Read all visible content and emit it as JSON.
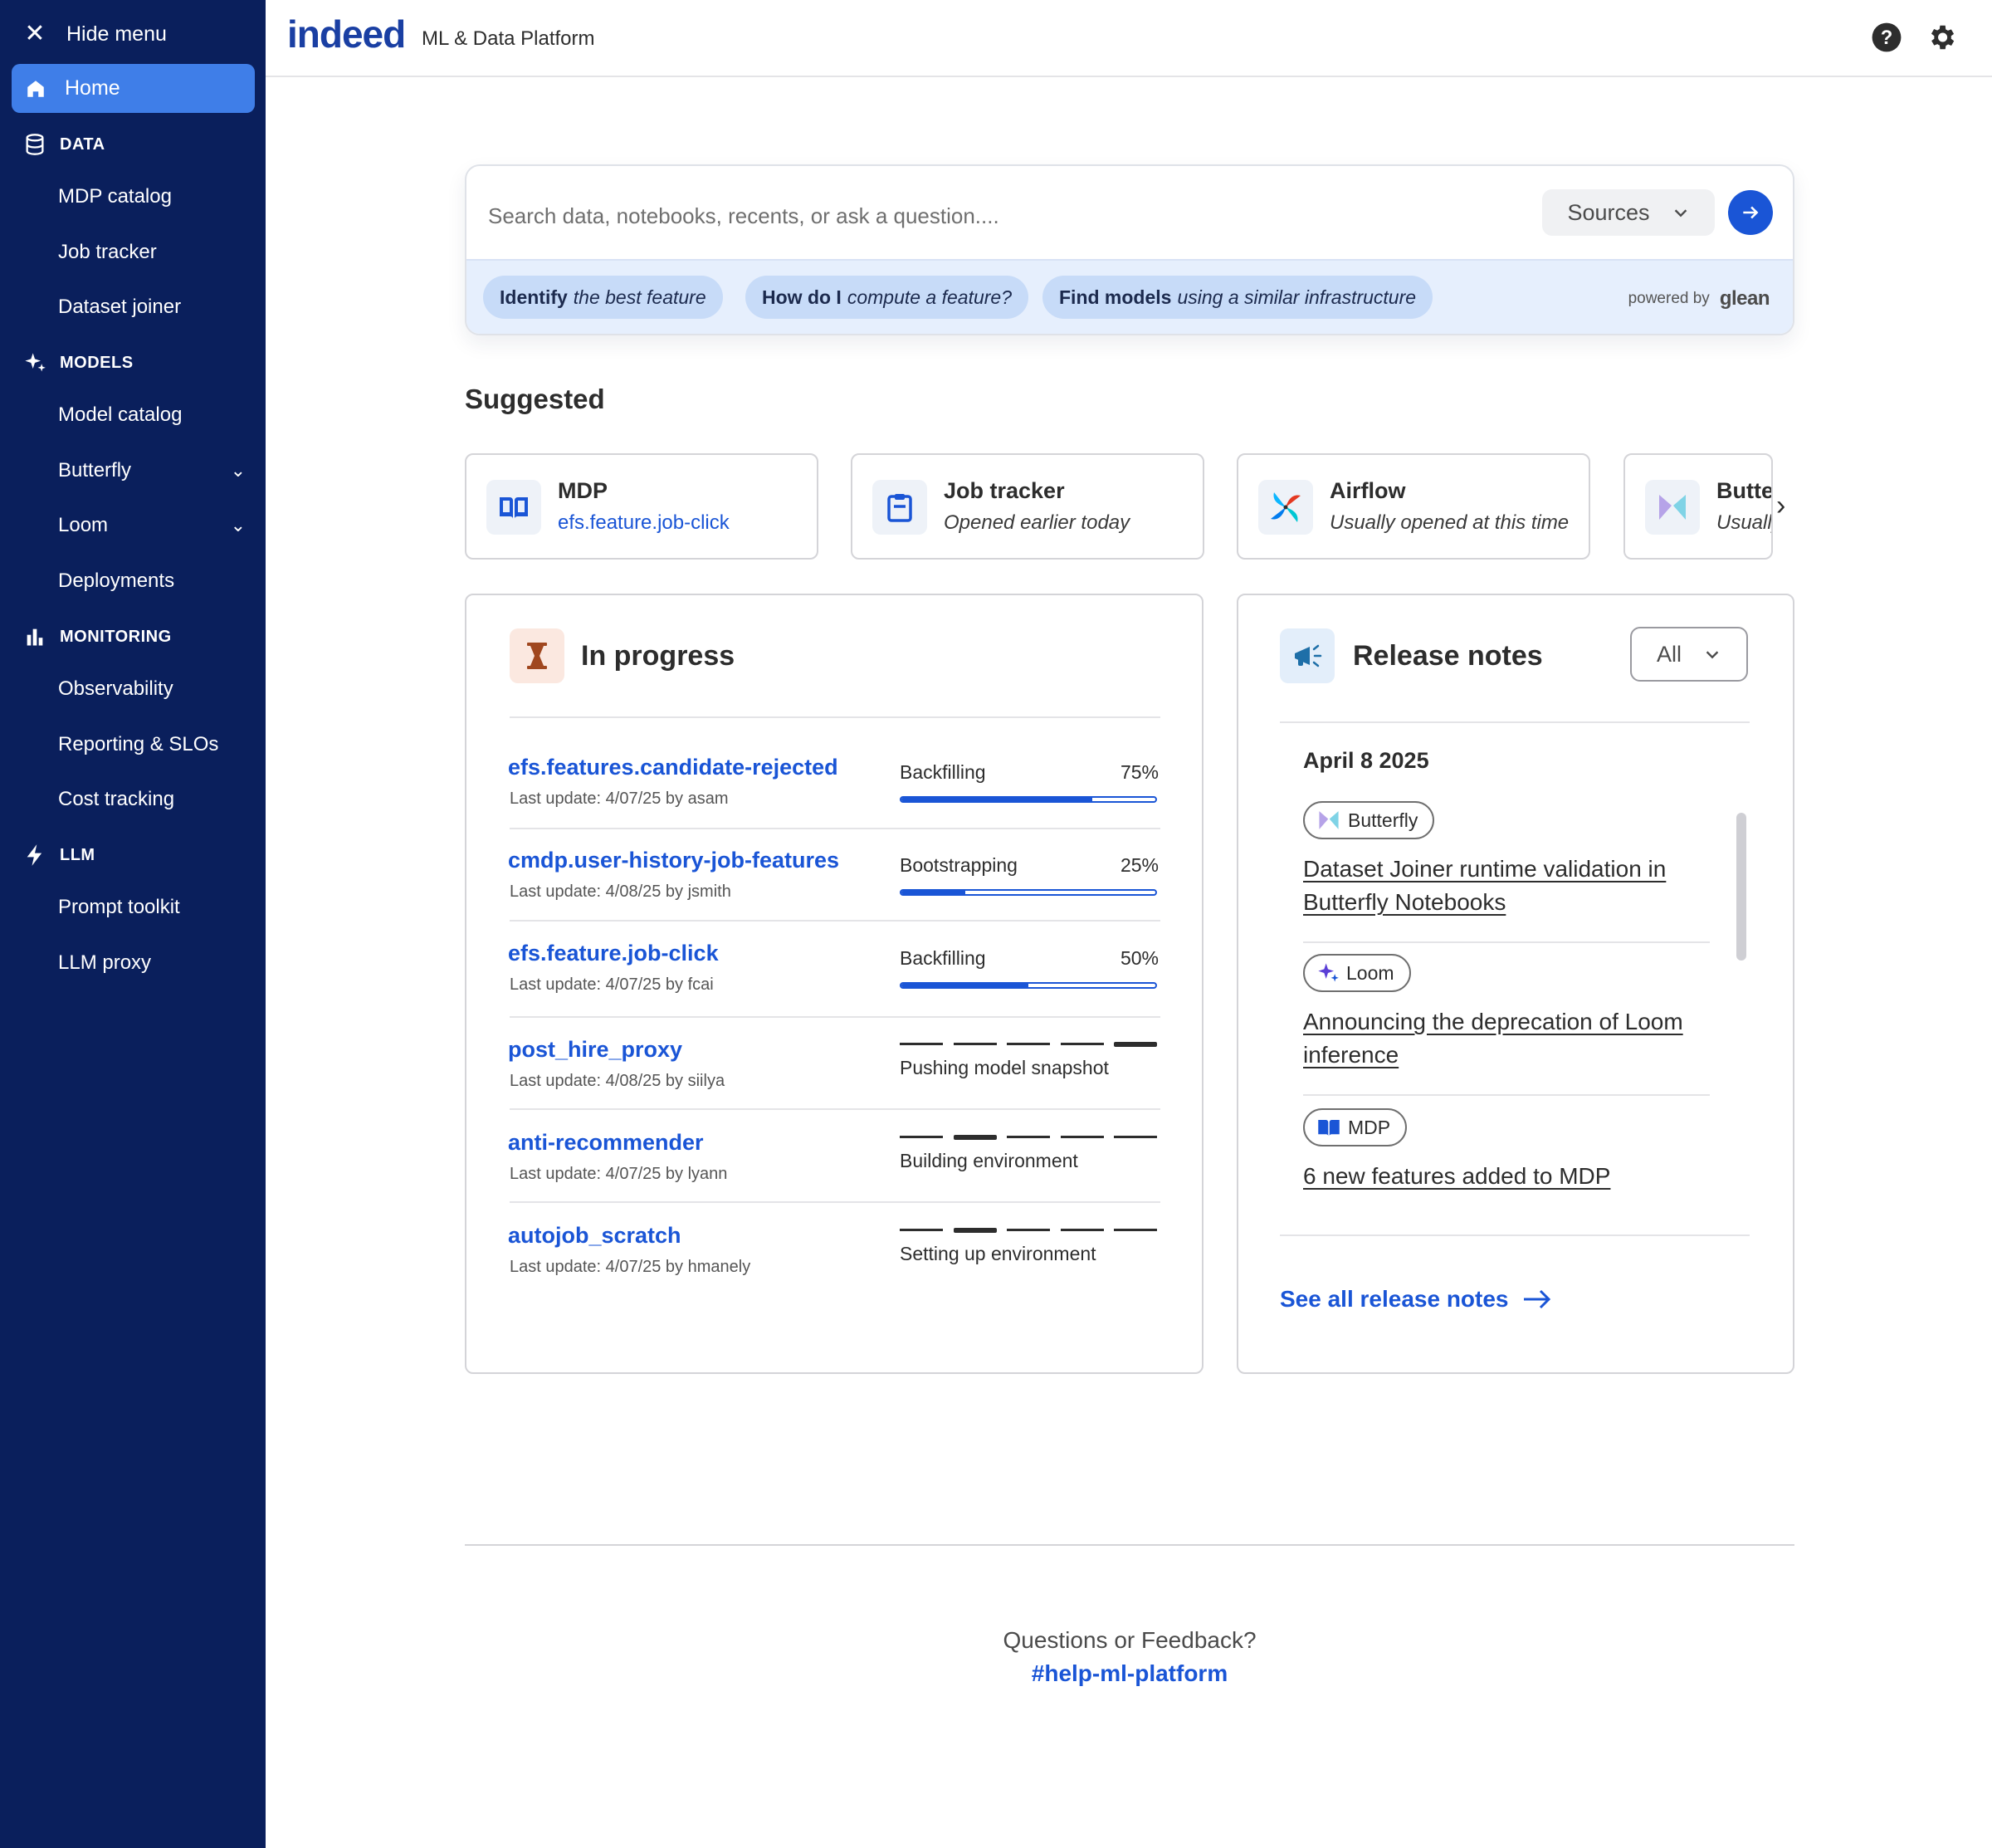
{
  "sidebar": {
    "hide_menu": "Hide menu",
    "home": "Home",
    "sections": [
      {
        "label": "DATA",
        "icon": "database-icon",
        "items": [
          {
            "label": "MDP catalog"
          },
          {
            "label": "Job tracker"
          },
          {
            "label": "Dataset joiner"
          }
        ]
      },
      {
        "label": "MODELS",
        "icon": "sparkle-icon",
        "items": [
          {
            "label": "Model catalog"
          },
          {
            "label": "Butterfly"
          },
          {
            "label": "Loom"
          },
          {
            "label": "Deployments"
          }
        ]
      },
      {
        "label": "MONITORING",
        "icon": "bar-chart-icon",
        "items": [
          {
            "label": "Observability"
          },
          {
            "label": "Reporting & SLOs"
          },
          {
            "label": "Cost tracking"
          }
        ]
      },
      {
        "label": "LLM",
        "icon": "bolt-icon",
        "items": [
          {
            "label": "Prompt toolkit"
          },
          {
            "label": "LLM proxy"
          }
        ]
      }
    ]
  },
  "header": {
    "logo": "indeed",
    "product": "ML & Data Platform"
  },
  "search": {
    "placeholder": "Search data, notebooks, recents, or ask a question....",
    "sources_label": "Sources",
    "chips": [
      {
        "bold": "Identify",
        "rest": "the best feature"
      },
      {
        "bold": "How do I",
        "rest": "compute a feature?"
      },
      {
        "bold": "Find models",
        "rest": "using a similar infrastructure"
      }
    ],
    "powered_by": "powered by",
    "powered_brand": "glean"
  },
  "suggested": {
    "title": "Suggested",
    "cards": [
      {
        "title": "MDP",
        "subtitle": "efs.feature.job-click",
        "icon": "book-icon"
      },
      {
        "title": "Job tracker",
        "subtitle": "Opened earlier today",
        "icon": "clipboard-icon"
      },
      {
        "title": "Airflow",
        "subtitle": "Usually opened at this time",
        "icon": "airflow-icon"
      },
      {
        "title": "Butterfly",
        "subtitle": "Usually opened at this time",
        "icon": "butterfly-icon"
      }
    ]
  },
  "in_progress": {
    "title": "In progress",
    "jobs": [
      {
        "name": "efs.features.candidate-rejected",
        "meta": "Last update: 4/07/25 by asam",
        "status": "Backfilling",
        "percent_label": "75%",
        "progress": 0.75
      },
      {
        "name": "cmdp.user-history-job-features",
        "meta": "Last update: 4/08/25 by jsmith",
        "status": "Bootstrapping",
        "percent_label": "25%",
        "progress": 0.25
      },
      {
        "name": "efs.feature.job-click",
        "meta": "Last update: 4/07/25 by fcai",
        "status": "Backfilling",
        "percent_label": "50%",
        "progress": 0.5
      },
      {
        "name": "post_hire_proxy",
        "meta": "Last update: 4/08/25 by siilya",
        "status": "Pushing model snapshot",
        "active_step": 5,
        "total_steps": 5
      },
      {
        "name": "anti-recommender",
        "meta": "Last update: 4/07/25 by lyann",
        "status": "Building environment",
        "active_step": 2,
        "total_steps": 5
      },
      {
        "name": "autojob_scratch",
        "meta": "Last update: 4/07/25 by hmanely",
        "status": "Setting up environment",
        "active_step": 2,
        "total_steps": 5
      }
    ]
  },
  "release_notes": {
    "title": "Release notes",
    "filter": "All",
    "date": "April 8 2025",
    "items": [
      {
        "tag": "Butterfly",
        "tag_icon": "butterfly-icon",
        "text": "Dataset Joiner runtime validation in Butterfly Notebooks"
      },
      {
        "tag": "Loom",
        "tag_icon": "sparkle-icon",
        "text": "Announcing the deprecation of Loom inference"
      },
      {
        "tag": "MDP",
        "tag_icon": "book-icon",
        "text": "6 new features added to MDP"
      }
    ],
    "see_all": "See all release notes"
  },
  "footer": {
    "question": "Questions or Feedback?",
    "channel": "#help-ml-platform"
  },
  "colors": {
    "sidebar_bg": "#0a1f5c",
    "accent": "#1a55d6",
    "home_active": "#3f7ee8",
    "chip_bg": "#c7dbf8"
  }
}
